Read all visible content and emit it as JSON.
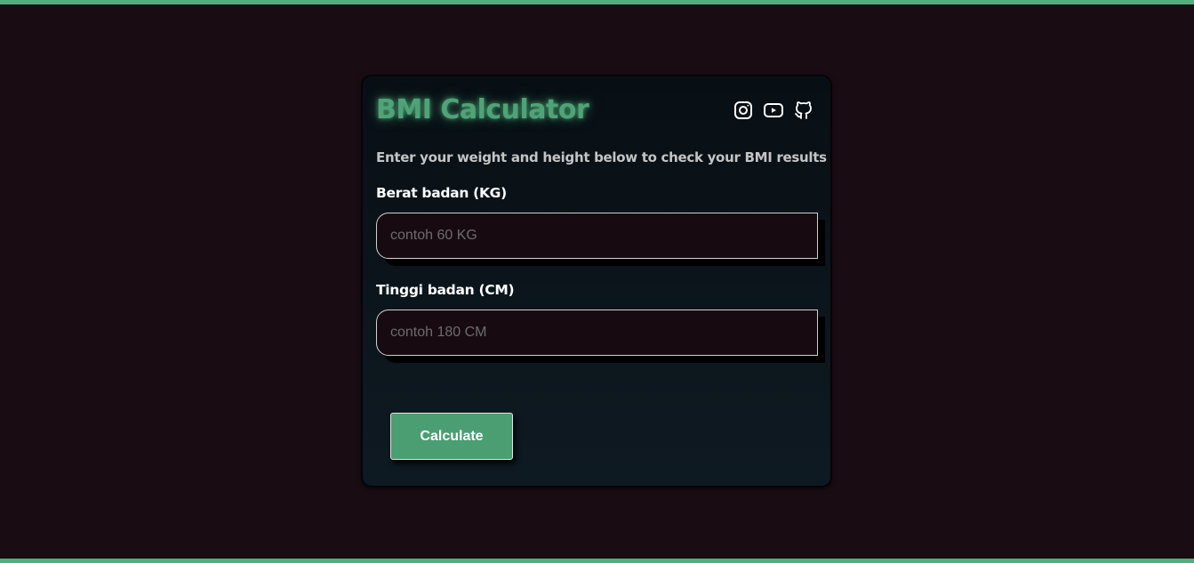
{
  "page": {
    "accent_color": "#52ae7c",
    "background_color": "#190d13"
  },
  "card": {
    "title": "BMI Calculator",
    "subtitle": "Enter your weight and height below to check your BMI results",
    "social_icons": [
      "instagram-icon",
      "youtube-icon",
      "github-icon"
    ]
  },
  "form": {
    "weight": {
      "label": "Berat badan (KG)",
      "placeholder": "contoh 60 KG",
      "value": ""
    },
    "height": {
      "label": "Tinggi badan (CM)",
      "placeholder": "contoh 180 CM",
      "value": ""
    },
    "calculate_label": "Calculate"
  }
}
